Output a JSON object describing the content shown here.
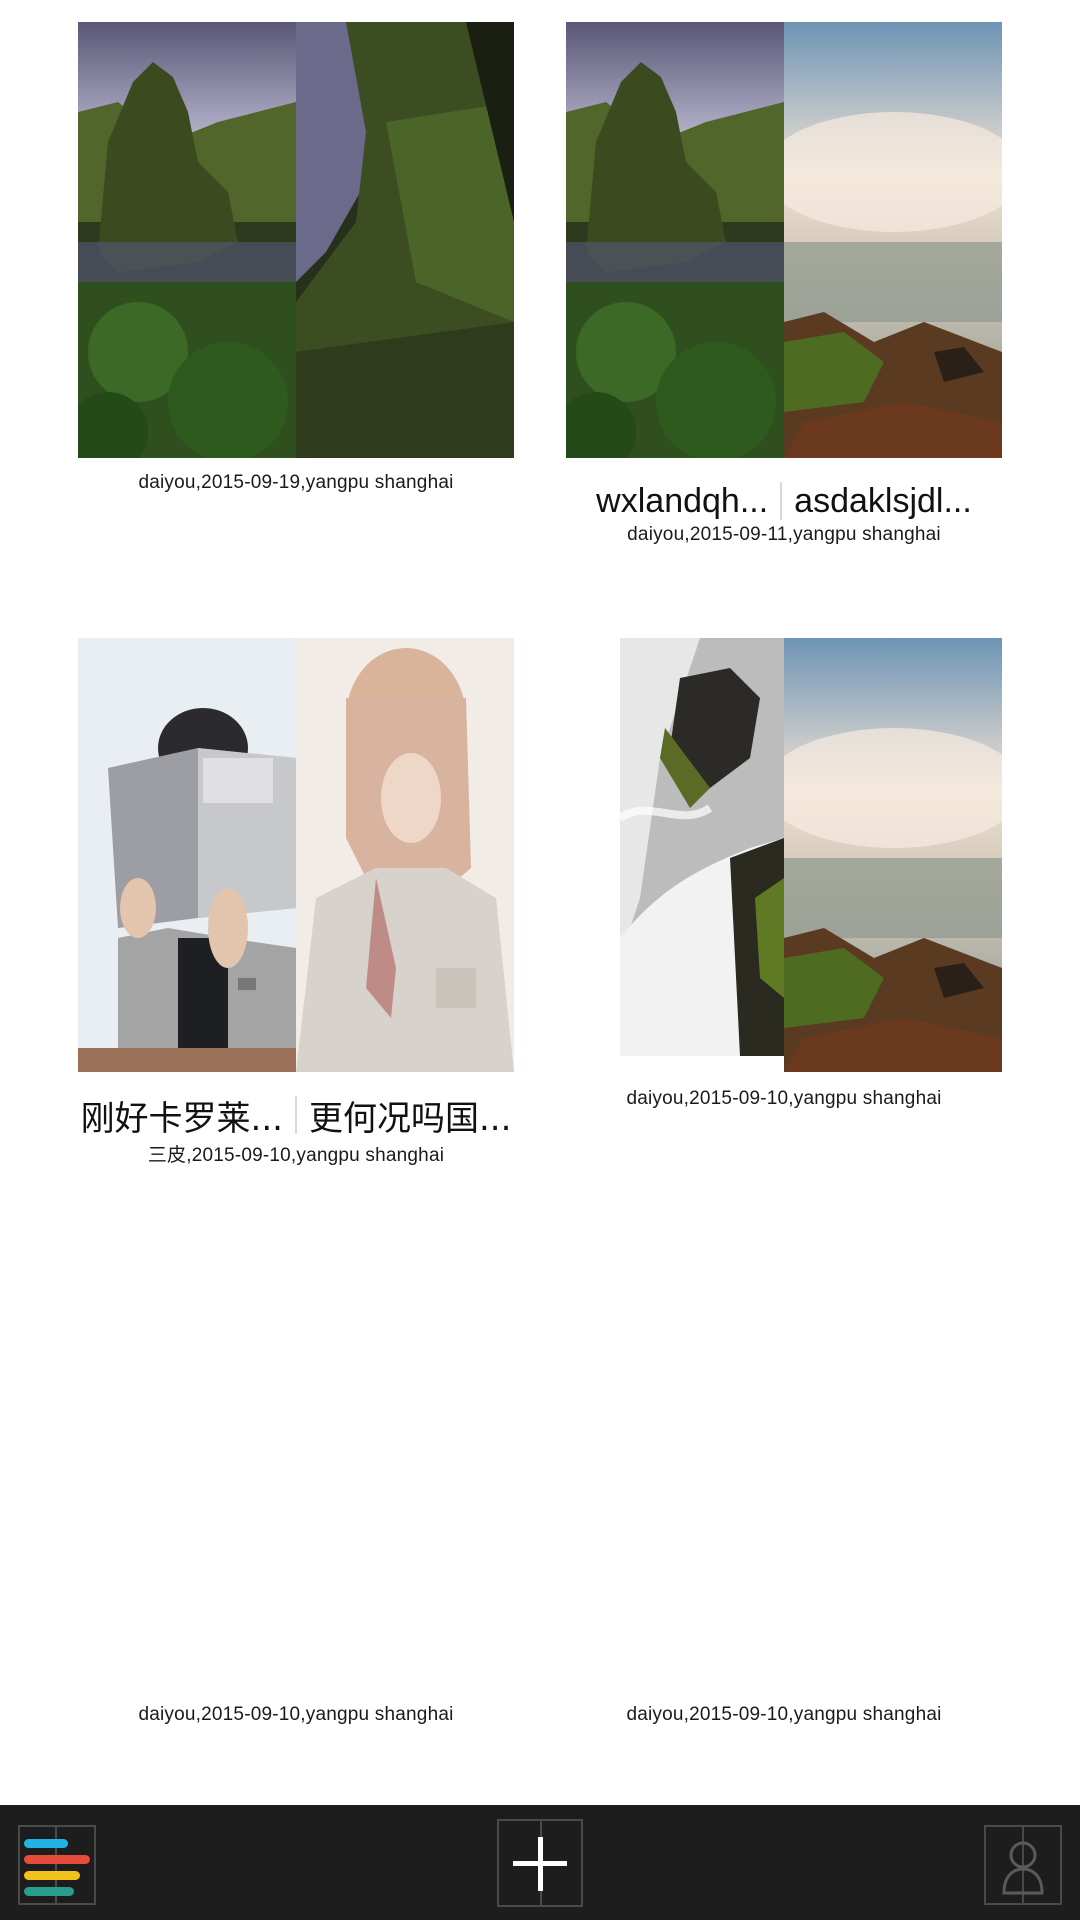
{
  "cards": [
    {
      "caption": "daiyou,2015-09-19,yangpu shanghai"
    },
    {
      "title_left": "wxlandqh...",
      "title_right": "asdaklsjdl...",
      "caption": "daiyou,2015-09-11,yangpu shanghai"
    },
    {
      "title_left": "刚好卡罗莱...",
      "title_right": "更何况吗国...",
      "caption": "三皮,2015-09-10,yangpu shanghai"
    },
    {
      "caption": "daiyou,2015-09-10,yangpu shanghai"
    },
    {
      "caption": "daiyou,2015-09-10,yangpu shanghai"
    },
    {
      "caption": "daiyou,2015-09-10,yangpu shanghai"
    }
  ],
  "toolbar": {
    "menu_icon": "colored-list-icon",
    "add_icon": "plus-icon",
    "profile_icon": "person-silhouette-icon",
    "menu_bar_colors": [
      "#1fb4e6",
      "#e64b3c",
      "#f2c21b",
      "#2a9d8f"
    ]
  }
}
